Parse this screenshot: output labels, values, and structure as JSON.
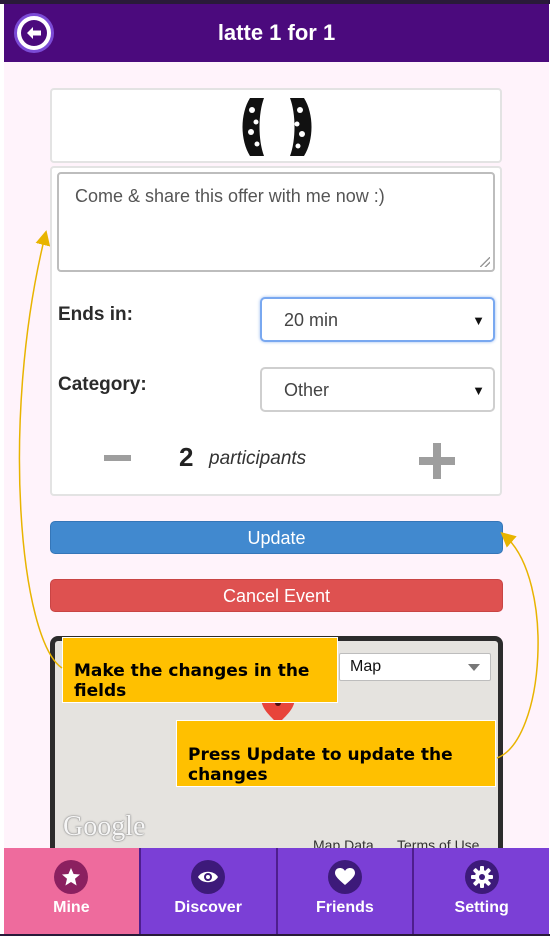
{
  "header": {
    "title": "latte 1 for 1"
  },
  "form": {
    "message": "Come & share this offer with me now :)",
    "ends_label": "Ends in:",
    "ends_value": "20 min",
    "category_label": "Category:",
    "category_value": "Other",
    "participants_count": "2",
    "participants_label": "participants"
  },
  "buttons": {
    "update": "Update",
    "cancel": "Cancel Event"
  },
  "map": {
    "type_value": "Map",
    "google_logo": "Google",
    "map_data": "Map Data",
    "terms": "Terms of Use"
  },
  "callouts": {
    "fields": "Make the changes in the fields",
    "update": "Press Update to update the changes"
  },
  "tabs": [
    {
      "label": "Mine",
      "icon": "star-icon"
    },
    {
      "label": "Discover",
      "icon": "eye-icon"
    },
    {
      "label": "Friends",
      "icon": "heart-icon"
    },
    {
      "label": "Setting",
      "icon": "gear-icon"
    }
  ],
  "colors": {
    "header_bg": "#4b0a7d",
    "update_button": "#4189cf",
    "cancel_button": "#de5150",
    "tab_active": "#ee6b9d",
    "tab_bar": "#7b3fd6",
    "callout": "#ffc000"
  }
}
